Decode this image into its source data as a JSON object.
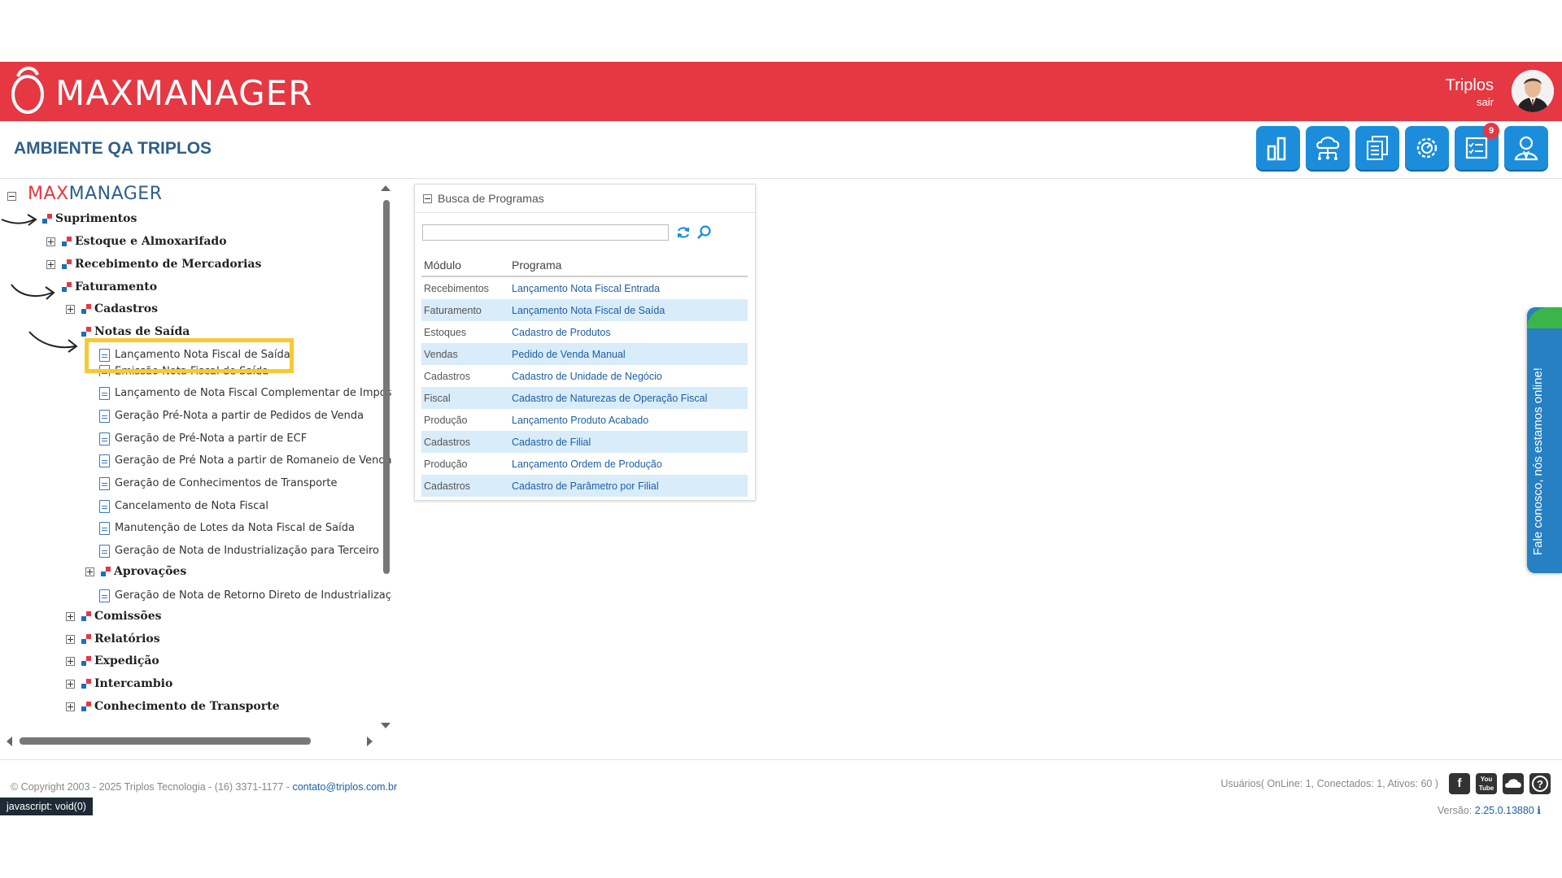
{
  "header": {
    "logo_text": "MAXMANAGER",
    "user_name": "Triplos",
    "logout": "sair"
  },
  "subheader": {
    "environment": "AMBIENTE QA TRIPLOS",
    "notification_count": "9",
    "tools": [
      "chart-icon",
      "cloud-network-icon",
      "documents-icon",
      "settings-icon",
      "checklist-icon",
      "user-profile-icon"
    ]
  },
  "tree": {
    "root_logo_red": "MAX",
    "root_logo_blue": "MANAGER",
    "nodes": [
      {
        "label": "Suprimentos"
      },
      {
        "label": "Estoque e Almoxarifado"
      },
      {
        "label": "Recebimento de Mercadorias"
      },
      {
        "label": "Faturamento"
      },
      {
        "label": "Cadastros"
      },
      {
        "label": "Notas de Saída"
      },
      {
        "label": "Lançamento Nota Fiscal de Saída"
      },
      {
        "label": "Emissão Nota Fiscal de Saída"
      },
      {
        "label": "Lançamento de Nota Fiscal Complementar de Imposto/"
      },
      {
        "label": "Geração Pré-Nota a partir de Pedidos de Venda"
      },
      {
        "label": "Geração de Pré-Nota a partir de ECF"
      },
      {
        "label": "Geração de Pré Nota a partir de Romaneio de Vendas"
      },
      {
        "label": "Geração de Conhecimentos de Transporte"
      },
      {
        "label": "Cancelamento de Nota Fiscal"
      },
      {
        "label": "Manutenção de Lotes da Nota Fiscal de Saída"
      },
      {
        "label": "Geração de Nota de Industrialização para Terceiro"
      },
      {
        "label": "Aprovações"
      },
      {
        "label": "Geração de Nota de Retorno Direto de Industrialização"
      },
      {
        "label": "Comissões"
      },
      {
        "label": "Relatórios"
      },
      {
        "label": "Expedição"
      },
      {
        "label": "Intercambio"
      },
      {
        "label": "Conhecimento de Transporte"
      }
    ]
  },
  "search": {
    "title": "Busca de Programas",
    "input_value": "",
    "columns": [
      "Módulo",
      "Programa"
    ],
    "rows": [
      {
        "module": "Recebimentos",
        "program": "Lançamento Nota Fiscal Entrada"
      },
      {
        "module": "Faturamento",
        "program": "Lançamento Nota Fiscal de Saída"
      },
      {
        "module": "Estoques",
        "program": "Cadastro de Produtos"
      },
      {
        "module": "Vendas",
        "program": "Pedido de Venda Manual"
      },
      {
        "module": "Cadastros",
        "program": "Cadastro de Unidade de Negócio"
      },
      {
        "module": "Fiscal",
        "program": "Cadastro de Naturezas de Operação Fiscal"
      },
      {
        "module": "Produção",
        "program": "Lançamento Produto Acabado"
      },
      {
        "module": "Cadastros",
        "program": "Cadastro de Filial"
      },
      {
        "module": "Produção",
        "program": "Lançamento Ordem de Produção"
      },
      {
        "module": "Cadastros",
        "program": "Cadastro de Parâmetro por Filial"
      }
    ]
  },
  "chat": {
    "label": "Fale conosco, nós estamos online!"
  },
  "footer": {
    "copyright": "© Copyright 2003 - 2025 Triplos Tecnologia - (16) 3371-1177 - ",
    "contact_email": "contato@triplos.com.br",
    "status_url": "javascript: void(0)",
    "users": "Usuários( OnLine: 1, Conectados: 1, Ativos: 60 )",
    "version_label": "Versão: ",
    "version_value": "2.25.0.13880",
    "social": [
      "facebook-icon",
      "youtube-icon",
      "cloud-icon",
      "help-icon"
    ]
  },
  "colors": {
    "header_red": "#e53843",
    "tool_blue": "#1c8ddb",
    "title_blue": "#2e5f88",
    "link_blue": "#1d5fa5",
    "row_alt": "#d9ecfa",
    "highlight": "#f7c934",
    "chat_green": "#3bb54a"
  }
}
